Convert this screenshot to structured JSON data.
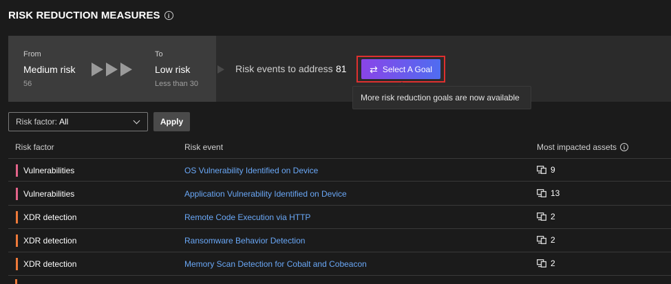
{
  "header": {
    "title": "RISK REDUCTION MEASURES",
    "info_icon": "info-icon"
  },
  "banner": {
    "from_label": "From",
    "from_value": "Medium risk",
    "from_score": "56",
    "to_label": "To",
    "to_value": "Low risk",
    "to_score": "Less than 30",
    "events_label": "Risk events to address",
    "events_count": "81",
    "goal_button": "Select A Goal",
    "goal_icon": "swap-arrows-icon",
    "tooltip": "More risk reduction goals are now available"
  },
  "filters": {
    "risk_factor_label": "Risk factor:",
    "risk_factor_value": "All",
    "apply_label": "Apply"
  },
  "table": {
    "columns": [
      "Risk factor",
      "Risk event",
      "Most impacted assets"
    ],
    "rows": [
      {
        "factor": "Vulnerabilities",
        "event": "OS Vulnerability Identified on Device",
        "assets": "9",
        "color": "#e3648a"
      },
      {
        "factor": "Vulnerabilities",
        "event": "Application Vulnerability Identified on Device",
        "assets": "13",
        "color": "#e3648a"
      },
      {
        "factor": "XDR detection",
        "event": "Remote Code Execution via HTTP",
        "assets": "2",
        "color": "#ef7a3a"
      },
      {
        "factor": "XDR detection",
        "event": "Ransomware Behavior Detection",
        "assets": "2",
        "color": "#ef7a3a"
      },
      {
        "factor": "XDR detection",
        "event": "Memory Scan Detection for Cobalt and Cobeacon",
        "assets": "2",
        "color": "#ef7a3a"
      }
    ]
  },
  "colors": {
    "accent_link": "#6aa8f7",
    "highlight": "#e0302f",
    "button_gradient_start": "#8a44e8",
    "button_gradient_end": "#4f6df0"
  }
}
